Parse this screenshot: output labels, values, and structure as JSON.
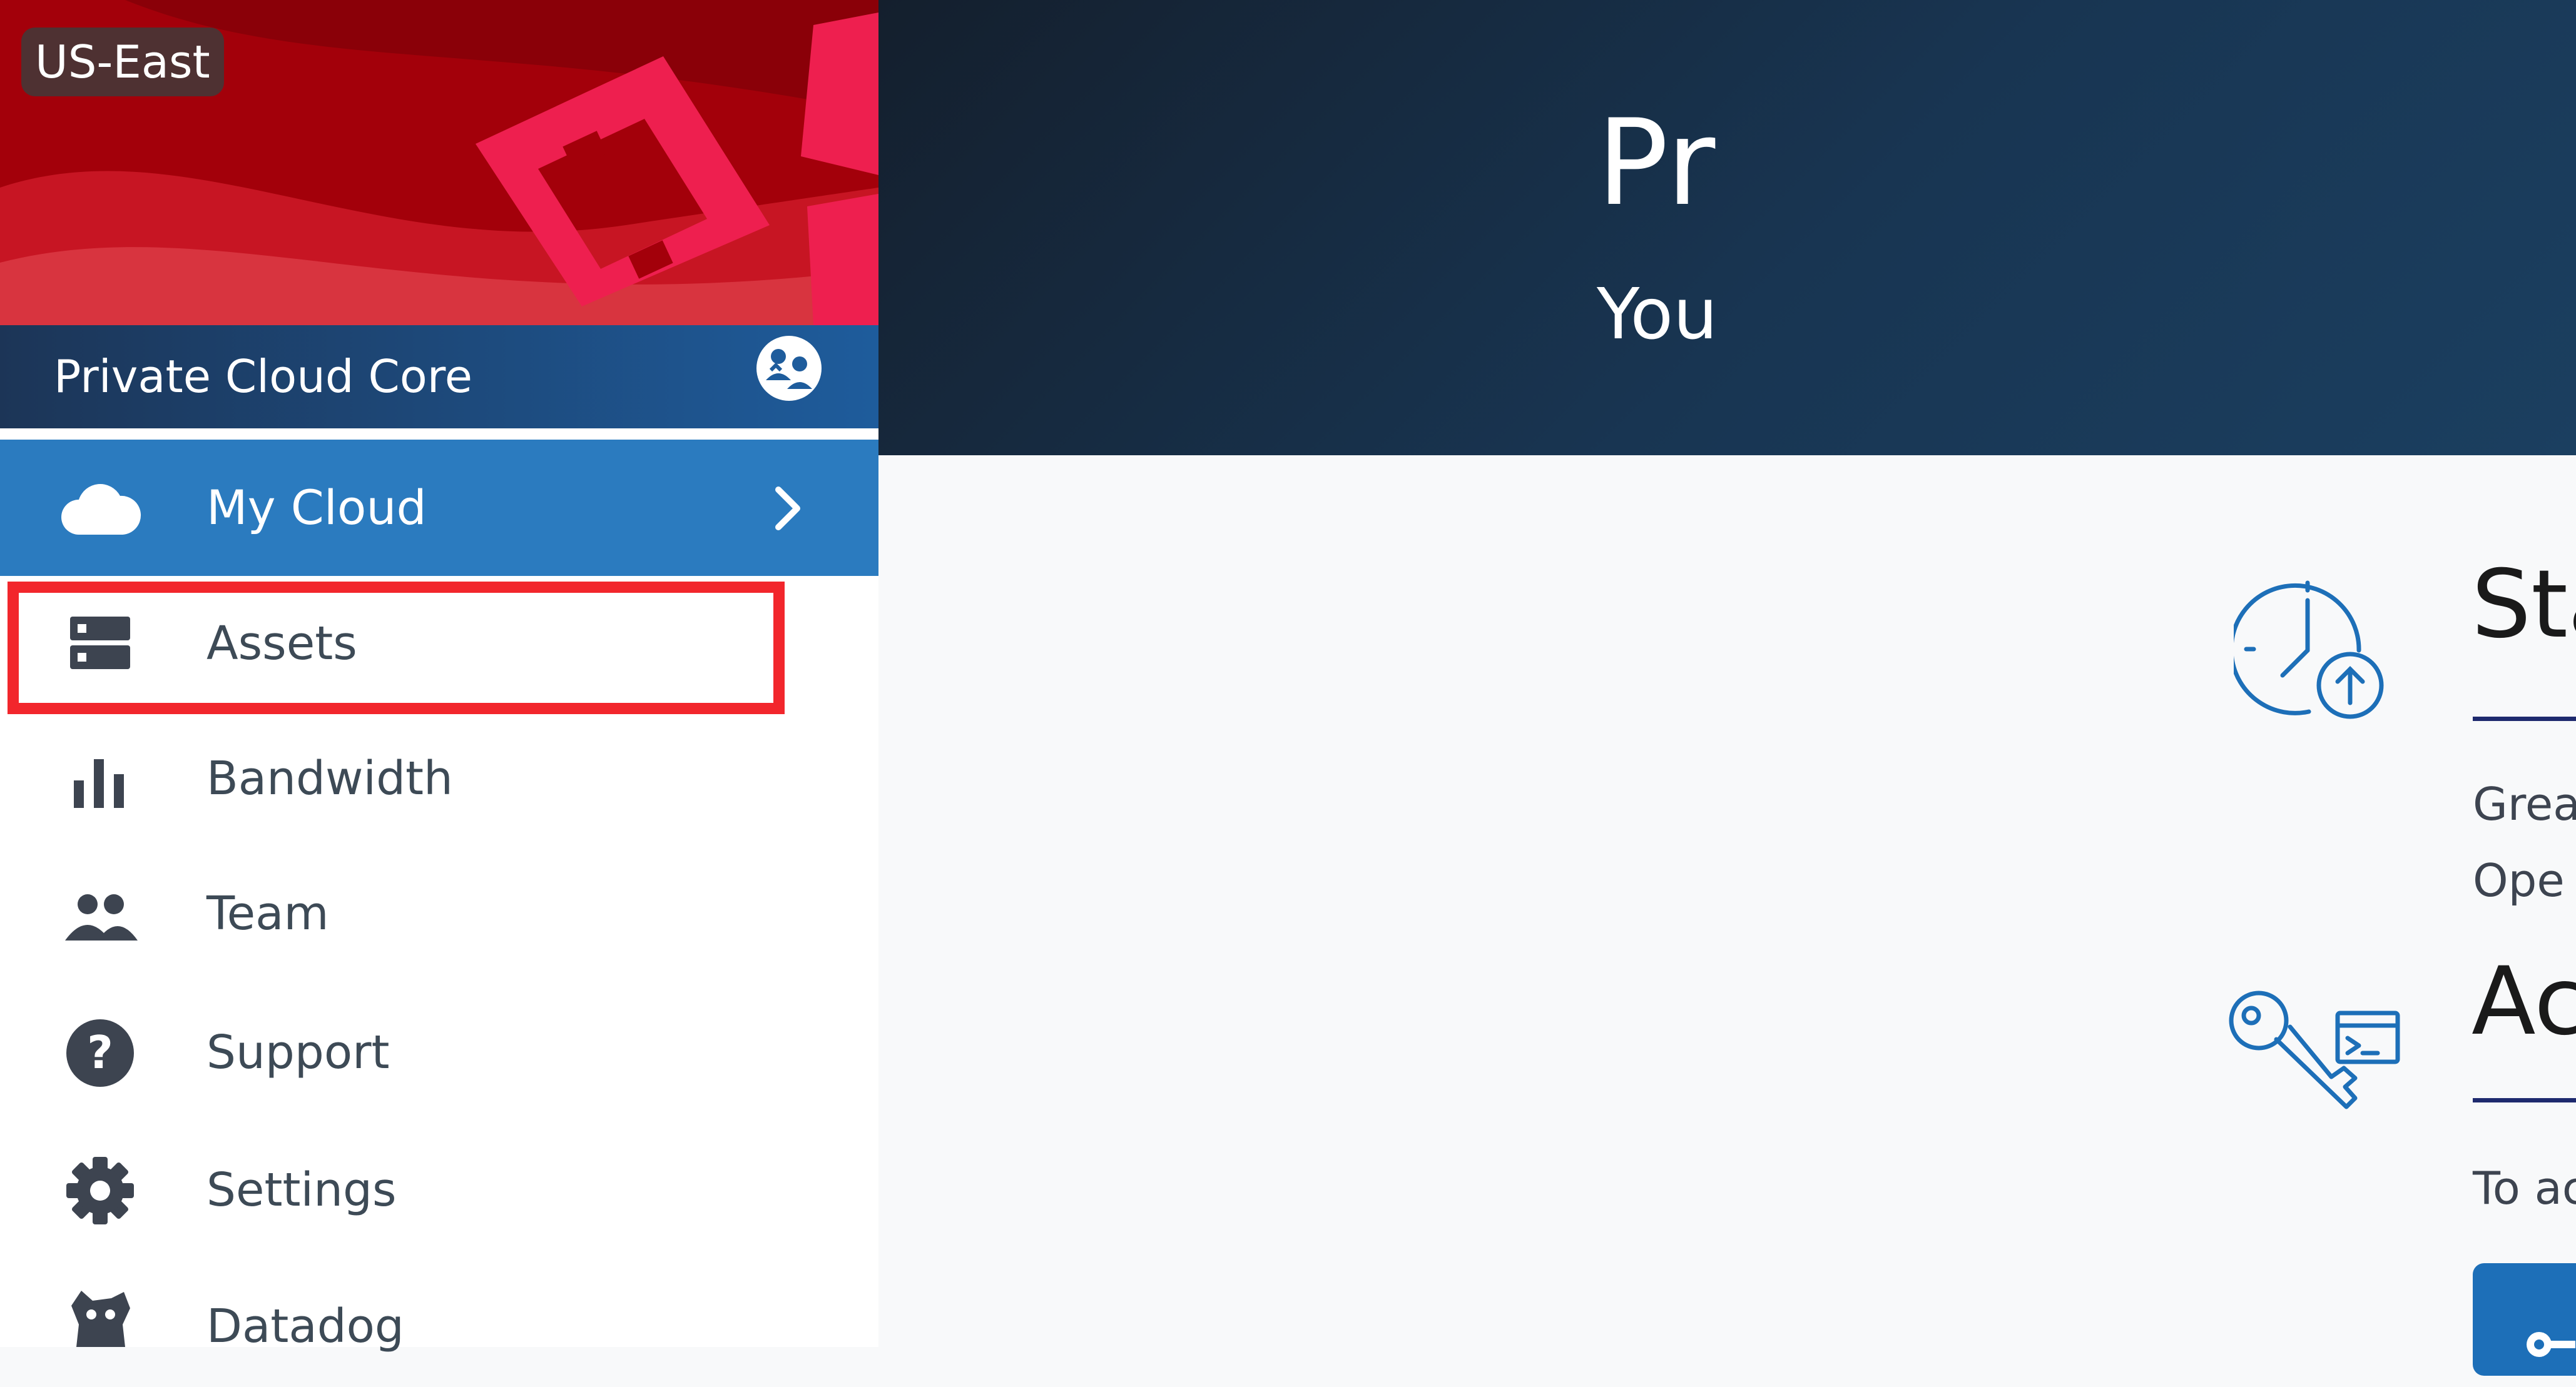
{
  "sidebar": {
    "region": "US-East",
    "product": "Private Cloud Core",
    "product_switch_icon": "team-swap-icon",
    "my_cloud": {
      "label": "My Cloud",
      "icon": "cloud-icon",
      "expand_icon": "chevron-right-icon"
    },
    "items": [
      {
        "label": "Assets",
        "icon": "server-icon",
        "highlighted": true
      },
      {
        "label": "Bandwidth",
        "icon": "bar-chart-icon"
      },
      {
        "label": "Team",
        "icon": "people-icon"
      },
      {
        "label": "Support",
        "icon": "help-icon"
      },
      {
        "label": "Settings",
        "icon": "gear-icon"
      },
      {
        "label": "Datadog",
        "icon": "datadog-icon"
      }
    ]
  },
  "hero": {
    "title": "Pr",
    "subtitle": "You"
  },
  "sections": [
    {
      "icon": "clock-upload-icon",
      "title": "Sta",
      "lines": [
        "Grea",
        "Ope"
      ]
    },
    {
      "icon": "key-terminal-icon",
      "title": "Ac",
      "lines": [
        "To ac"
      ]
    }
  ],
  "colors": {
    "sidebar_active": "#2b7bbf",
    "hero_bg": "#183552",
    "highlight_border": "#f2262c",
    "accent_rule": "#1e2a6e"
  }
}
